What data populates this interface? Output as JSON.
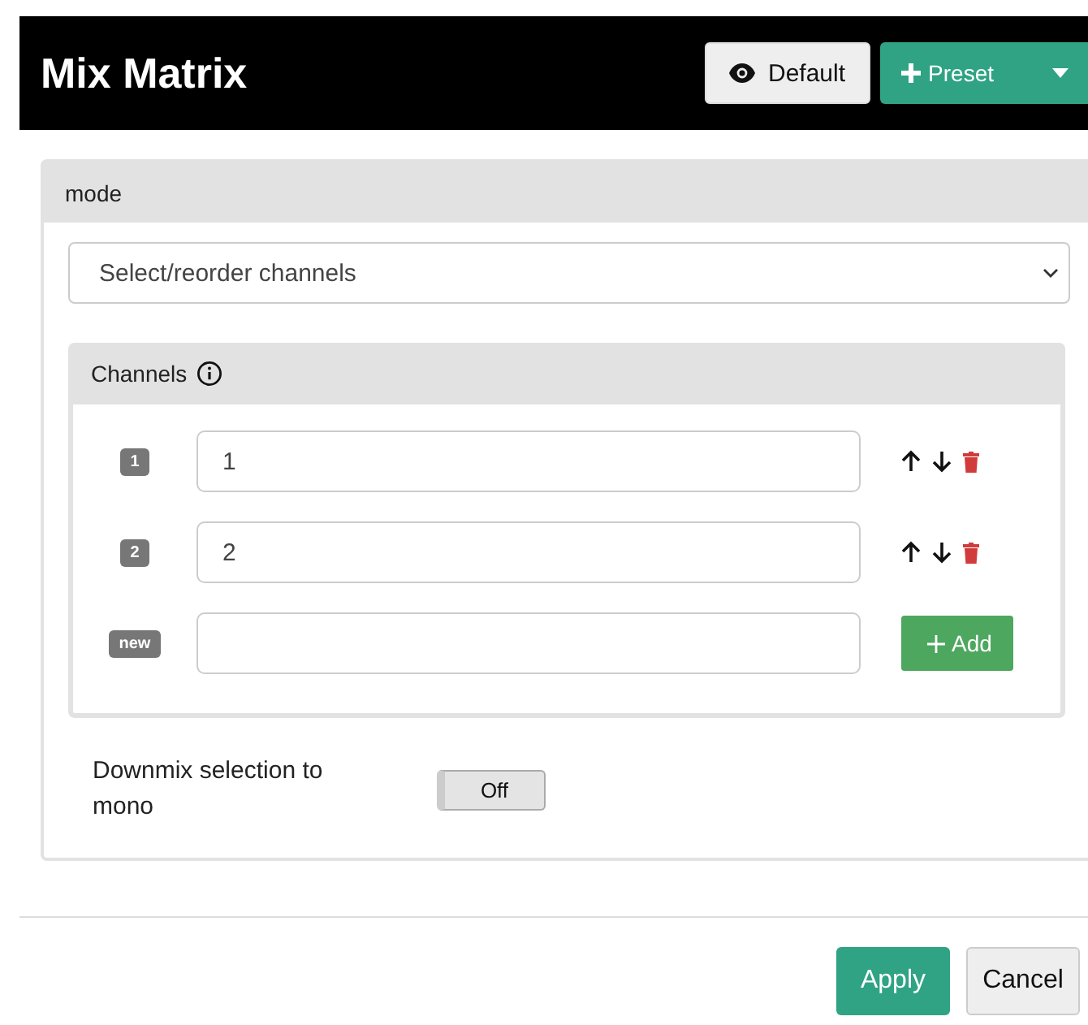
{
  "header": {
    "title": "Mix Matrix",
    "buttons": [
      {
        "kind": "default",
        "label": "Default"
      },
      {
        "kind": "preset",
        "label": "Preset"
      }
    ]
  },
  "mode": {
    "heading": "mode",
    "value": "Select/reorder channels"
  },
  "channels": {
    "heading": "Channels",
    "rows": [
      {
        "kind": "channel",
        "badge": "1",
        "value": "1"
      },
      {
        "kind": "channel",
        "badge": "2",
        "value": "2"
      },
      {
        "kind": "new",
        "badge": "new",
        "button": "Add"
      }
    ]
  },
  "downmix": {
    "label": "Downmix selection to mono",
    "on": false,
    "state_text": "Off"
  },
  "footer": {
    "buttons": [
      {
        "kind": "primary",
        "label": "Apply"
      },
      {
        "kind": "secondary",
        "label": "Cancel"
      }
    ]
  }
}
